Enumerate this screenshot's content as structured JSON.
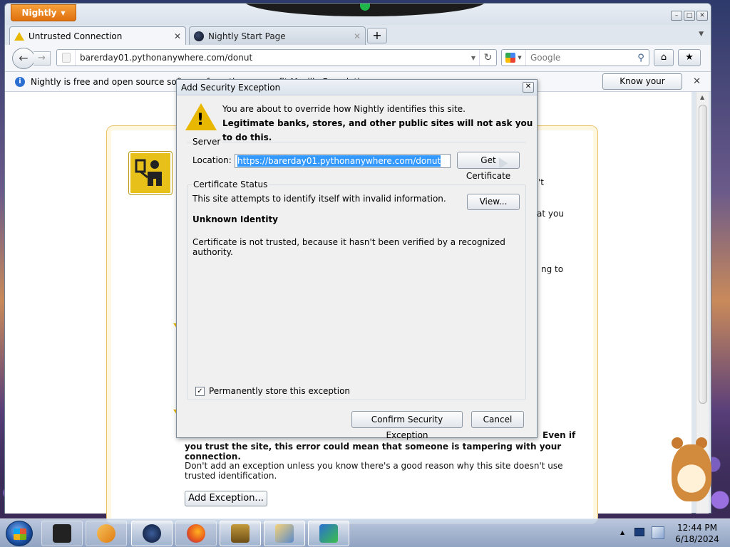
{
  "browser": {
    "app_button": "Nightly",
    "tabs": [
      {
        "label": "Untrusted Connection",
        "active": true
      },
      {
        "label": "Nightly Start Page",
        "active": false
      }
    ],
    "url": "barerday01.pythonanywhere.com/donut",
    "search_placeholder": "Google",
    "notification": {
      "text": "Nightly is free and open source software from the non-profit Mozilla Foundation.",
      "button": "Know your rights..."
    }
  },
  "error_page": {
    "fragment_1": "'t",
    "fragment_2": "at you",
    "fragment_3": "ng to",
    "warning_tail": "Even if",
    "warning_text": "you trust the site, this error could mean that someone is tampering with your connection.",
    "advice": "Don't add an exception unless you know there's a good reason why this site doesn't use trusted identification.",
    "add_exception": "Add Exception..."
  },
  "dialog": {
    "title": "Add Security Exception",
    "intro_line1": "You are about to override how Nightly identifies this site.",
    "intro_line2": "Legitimate banks, stores, and other public sites will not ask you to do this.",
    "server_legend": "Server",
    "location_label": "Location:",
    "location_value": "https://barerday01.pythonanywhere.com/donut",
    "get_certificate": "Get Certificate",
    "status_legend": "Certificate Status",
    "status_line": "This site attempts to identify itself with invalid information.",
    "view_button": "View...",
    "identity_heading": "Unknown Identity",
    "identity_detail": "Certificate is not trusted, because it hasn't been verified by a recognized authority.",
    "permanent_label": "Permanently store this exception",
    "permanent_checked": true,
    "confirm_button": "Confirm Security Exception",
    "cancel_button": "Cancel"
  },
  "taskbar": {
    "time": "12:44 PM",
    "date": "6/18/2024",
    "items": [
      "media-center-icon",
      "media-player-icon",
      "nightly-icon",
      "firefox-icon",
      "box-game-icon",
      "presentation-icon",
      "security-center-icon"
    ]
  },
  "colors": {
    "app_button": "#e0700e",
    "warning_yellow": "#e8b700",
    "selection": "#3399ff"
  }
}
